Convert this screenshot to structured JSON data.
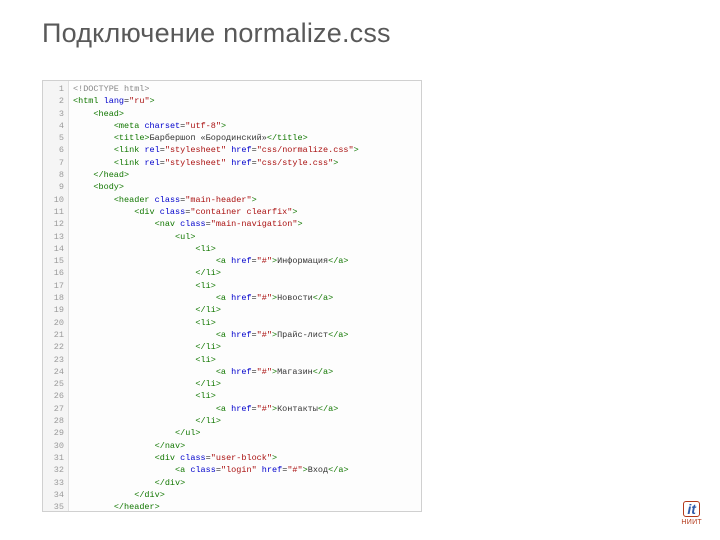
{
  "title": "Подключение normalize.css",
  "logo": {
    "it": "it",
    "label": "НИИТ"
  },
  "lines": [
    {
      "n": "1",
      "indent": 0,
      "html": "<span class='doctype'>&lt;!DOCTYPE html&gt;</span>"
    },
    {
      "n": "2",
      "indent": 0,
      "html": "<span class='tag'>&lt;html</span> <span class='attr'>lang</span>=<span class='val'>\"ru\"</span><span class='tag'>&gt;</span>"
    },
    {
      "n": "3",
      "indent": 1,
      "html": "<span class='tag'>&lt;head&gt;</span>"
    },
    {
      "n": "4",
      "indent": 2,
      "html": "<span class='tag'>&lt;meta</span> <span class='attr'>charset</span>=<span class='val'>\"utf-8\"</span><span class='tag'>&gt;</span>"
    },
    {
      "n": "5",
      "indent": 2,
      "html": "<span class='tag'>&lt;title&gt;</span><span class='text'>Барбершоп «Бородинский»</span><span class='tag'>&lt;/title&gt;</span>"
    },
    {
      "n": "6",
      "indent": 2,
      "html": "<span class='tag'>&lt;link</span> <span class='attr'>rel</span>=<span class='val'>\"stylesheet\"</span> <span class='attr'>href</span>=<span class='val'>\"css/normalize.css\"</span><span class='tag'>&gt;</span>"
    },
    {
      "n": "7",
      "indent": 2,
      "html": "<span class='tag'>&lt;link</span> <span class='attr'>rel</span>=<span class='val'>\"stylesheet\"</span> <span class='attr'>href</span>=<span class='val'>\"css/style.css\"</span><span class='tag'>&gt;</span>"
    },
    {
      "n": "8",
      "indent": 1,
      "html": "<span class='tag'>&lt;/head&gt;</span>"
    },
    {
      "n": "9",
      "indent": 1,
      "html": "<span class='tag'>&lt;body&gt;</span>"
    },
    {
      "n": "10",
      "indent": 2,
      "html": "<span class='tag'>&lt;header</span> <span class='attr'>class</span>=<span class='val'>\"main-header\"</span><span class='tag'>&gt;</span>"
    },
    {
      "n": "11",
      "indent": 3,
      "html": "<span class='tag'>&lt;div</span> <span class='attr'>class</span>=<span class='val'>\"container clearfix\"</span><span class='tag'>&gt;</span>"
    },
    {
      "n": "12",
      "indent": 4,
      "html": "<span class='tag'>&lt;nav</span> <span class='attr'>class</span>=<span class='val'>\"main-navigation\"</span><span class='tag'>&gt;</span>"
    },
    {
      "n": "13",
      "indent": 5,
      "html": "<span class='tag'>&lt;ul&gt;</span>"
    },
    {
      "n": "14",
      "indent": 6,
      "html": "<span class='tag'>&lt;li&gt;</span>"
    },
    {
      "n": "15",
      "indent": 7,
      "html": "<span class='tag'>&lt;a</span> <span class='attr'>href</span>=<span class='val'>\"#\"</span><span class='tag'>&gt;</span><span class='text'>Информация</span><span class='tag'>&lt;/a&gt;</span>"
    },
    {
      "n": "16",
      "indent": 6,
      "html": "<span class='tag'>&lt;/li&gt;</span>"
    },
    {
      "n": "17",
      "indent": 6,
      "html": "<span class='tag'>&lt;li&gt;</span>"
    },
    {
      "n": "18",
      "indent": 7,
      "html": "<span class='tag'>&lt;a</span> <span class='attr'>href</span>=<span class='val'>\"#\"</span><span class='tag'>&gt;</span><span class='text'>Новости</span><span class='tag'>&lt;/a&gt;</span>"
    },
    {
      "n": "19",
      "indent": 6,
      "html": "<span class='tag'>&lt;/li&gt;</span>"
    },
    {
      "n": "20",
      "indent": 6,
      "html": "<span class='tag'>&lt;li&gt;</span>"
    },
    {
      "n": "21",
      "indent": 7,
      "html": "<span class='tag'>&lt;a</span> <span class='attr'>href</span>=<span class='val'>\"#\"</span><span class='tag'>&gt;</span><span class='text'>Прайс-лист</span><span class='tag'>&lt;/a&gt;</span>"
    },
    {
      "n": "22",
      "indent": 6,
      "html": "<span class='tag'>&lt;/li&gt;</span>"
    },
    {
      "n": "23",
      "indent": 6,
      "html": "<span class='tag'>&lt;li&gt;</span>"
    },
    {
      "n": "24",
      "indent": 7,
      "html": "<span class='tag'>&lt;a</span> <span class='attr'>href</span>=<span class='val'>\"#\"</span><span class='tag'>&gt;</span><span class='text'>Магазин</span><span class='tag'>&lt;/a&gt;</span>"
    },
    {
      "n": "25",
      "indent": 6,
      "html": "<span class='tag'>&lt;/li&gt;</span>"
    },
    {
      "n": "26",
      "indent": 6,
      "html": "<span class='tag'>&lt;li&gt;</span>"
    },
    {
      "n": "27",
      "indent": 7,
      "html": "<span class='tag'>&lt;a</span> <span class='attr'>href</span>=<span class='val'>\"#\"</span><span class='tag'>&gt;</span><span class='text'>Контакты</span><span class='tag'>&lt;/a&gt;</span>"
    },
    {
      "n": "28",
      "indent": 6,
      "html": "<span class='tag'>&lt;/li&gt;</span>"
    },
    {
      "n": "29",
      "indent": 5,
      "html": "<span class='tag'>&lt;/ul&gt;</span>"
    },
    {
      "n": "30",
      "indent": 4,
      "html": "<span class='tag'>&lt;/nav&gt;</span>"
    },
    {
      "n": "31",
      "indent": 4,
      "html": "<span class='tag'>&lt;div</span> <span class='attr'>class</span>=<span class='val'>\"user-block\"</span><span class='tag'>&gt;</span>"
    },
    {
      "n": "32",
      "indent": 5,
      "html": "<span class='tag'>&lt;a</span> <span class='attr'>class</span>=<span class='val'>\"login\"</span> <span class='attr'>href</span>=<span class='val'>\"#\"</span><span class='tag'>&gt;</span><span class='text'>Вход</span><span class='tag'>&lt;/a&gt;</span>"
    },
    {
      "n": "33",
      "indent": 4,
      "html": "<span class='tag'>&lt;/div&gt;</span>"
    },
    {
      "n": "34",
      "indent": 3,
      "html": "<span class='tag'>&lt;/div&gt;</span>"
    },
    {
      "n": "35",
      "indent": 2,
      "html": "<span class='tag'>&lt;/header&gt;</span>"
    }
  ]
}
